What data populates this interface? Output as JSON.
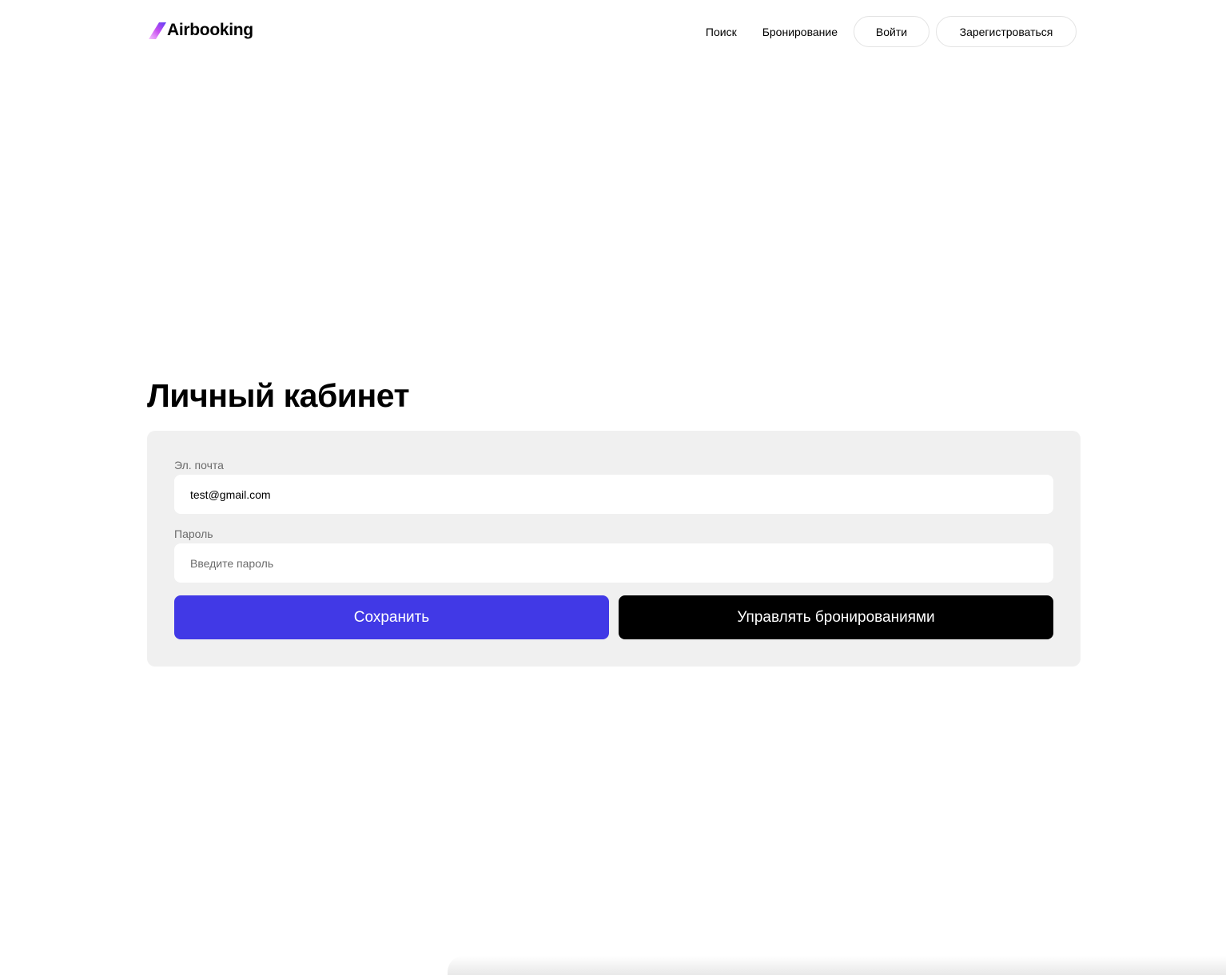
{
  "brand": {
    "name": "Airbooking",
    "logo_icon": "slanted-bar-icon",
    "logo_gradient": [
      "#f5b8ff",
      "#c84ff0",
      "#5b3df5"
    ]
  },
  "nav": {
    "links": [
      "Поиск",
      "Бронирование"
    ],
    "login_label": "Войти",
    "register_label": "Зарегистроваться"
  },
  "page": {
    "title": "Личный кабинет"
  },
  "form": {
    "email_label": "Эл. почта",
    "email_value": "test@gmail.com",
    "password_label": "Пароль",
    "password_placeholder": "Введите пароль",
    "save_label": "Сохранить",
    "manage_label": "Управлять бронированиями"
  },
  "colors": {
    "accent": "#4139e6",
    "dark_button": "#000000",
    "card_bg": "#f0f0f0"
  }
}
